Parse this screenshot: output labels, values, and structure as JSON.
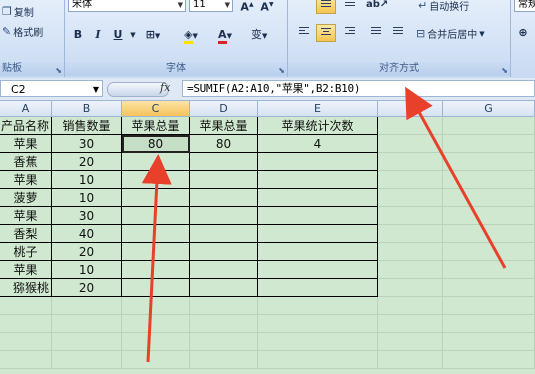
{
  "ribbon": {
    "clipboard": {
      "copy": "复制",
      "format_painter": "格式刷",
      "group": "贴板"
    },
    "font": {
      "font_name": "宋体",
      "font_size": "11",
      "group": "字体"
    },
    "align": {
      "wrap": "自动换行",
      "merge": "合并后居中",
      "group": "对齐方式"
    },
    "number": {
      "format": "常规"
    }
  },
  "formula_bar": {
    "name_box": "C2",
    "fx": "fx",
    "formula": "=SUMIF(A2:A10,\"苹果\",B2:B10)"
  },
  "columns": [
    "A",
    "B",
    "C",
    "D",
    "E",
    "F",
    "G"
  ],
  "sheet": {
    "headers": [
      "产品名称",
      "销售数量",
      "苹果总量",
      "苹果总量",
      "苹果统计次数"
    ],
    "rows": [
      [
        "苹果",
        "30",
        "80",
        "80",
        "4"
      ],
      [
        "香蕉",
        "20",
        "",
        "",
        ""
      ],
      [
        "苹果",
        "10",
        "",
        "",
        ""
      ],
      [
        "菠萝",
        "10",
        "",
        "",
        ""
      ],
      [
        "苹果",
        "30",
        "",
        "",
        ""
      ],
      [
        "香梨",
        "40",
        "",
        "",
        ""
      ],
      [
        "桃子",
        "20",
        "",
        "",
        ""
      ],
      [
        "苹果",
        "10",
        "",
        "",
        ""
      ],
      [
        "猕猴桃",
        "20",
        "",
        "",
        ""
      ]
    ]
  },
  "colors": {
    "selection": "#f5c35b",
    "annotation_arrow": "#e8402a",
    "sheet_bg": "#cfe8cf"
  }
}
